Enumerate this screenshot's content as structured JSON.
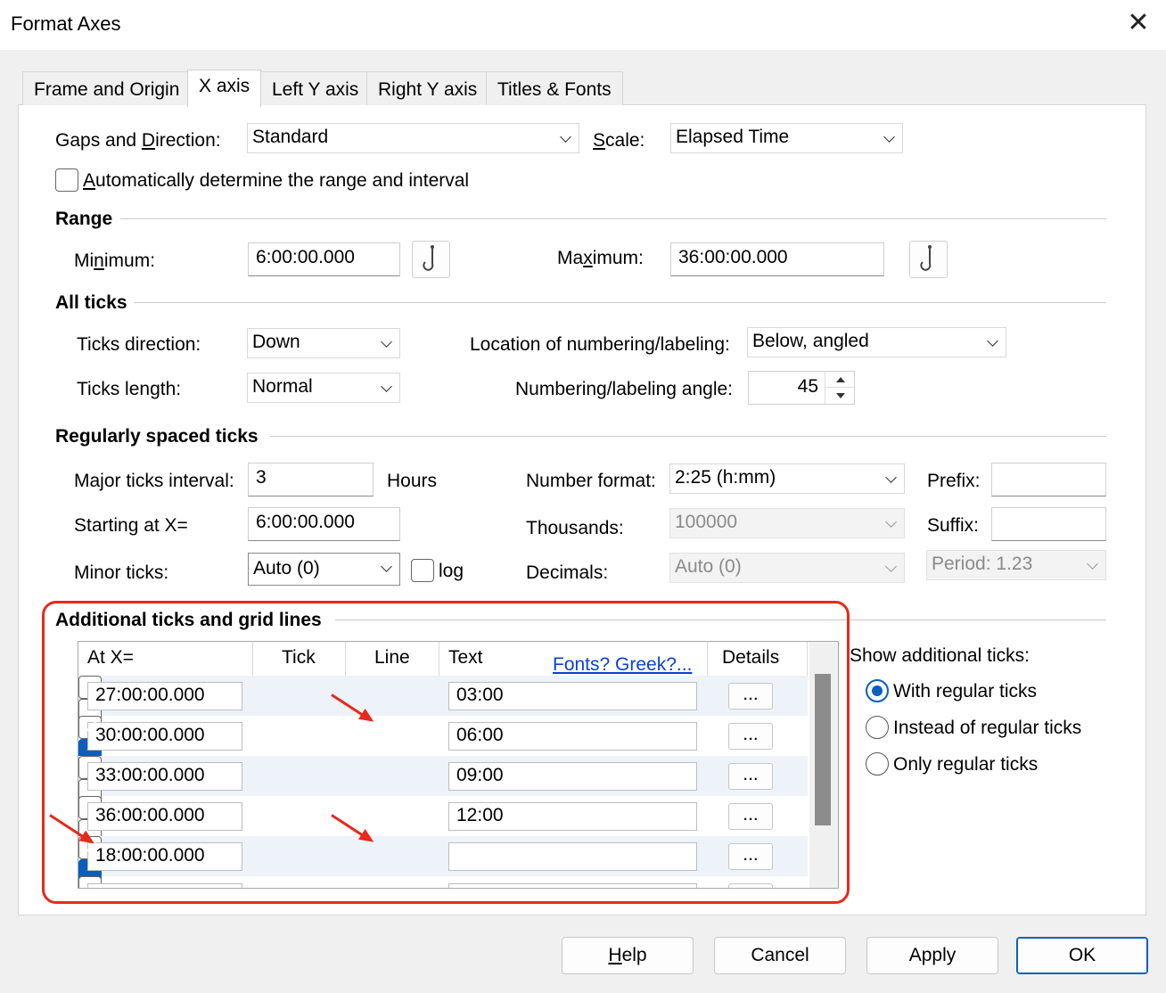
{
  "window": {
    "title": "Format Axes",
    "close_glyph": "✕"
  },
  "tabs": [
    "Frame and Origin",
    "X axis",
    "Left Y axis",
    "Right Y axis",
    "Titles & Fonts"
  ],
  "active_tab": "X axis",
  "gaps": {
    "label_pre": "Gaps and ",
    "label_key": "D",
    "label_post": "irection:",
    "value": "Standard"
  },
  "scale": {
    "label_key": "S",
    "label_post": "cale:",
    "value": "Elapsed Time"
  },
  "auto_range": {
    "label_key": "A",
    "label_post": "utomatically determine the range and interval",
    "checked": false
  },
  "range": {
    "heading": "Range",
    "min_label_pre": "Mi",
    "min_label_key": "n",
    "min_label_post": "imum:",
    "min_value": "6:00:00.000",
    "max_label_pre": "Ma",
    "max_label_key": "x",
    "max_label_post": "imum:",
    "max_value": "36:00:00.000",
    "hook_glyph": "⚓"
  },
  "all_ticks": {
    "heading": "All ticks",
    "direction_label": "Ticks direction:",
    "direction_value": "Down",
    "length_label": "Ticks length:",
    "length_value": "Normal",
    "location_label": "Location of numbering/labeling:",
    "location_value": "Below, angled",
    "angle_label": "Numbering/labeling angle:",
    "angle_value": "45"
  },
  "regular": {
    "heading": "Regularly spaced ticks",
    "major_label": "Major ticks interval:",
    "major_value": "3",
    "major_unit": "Hours",
    "start_label": "Starting at X=",
    "start_value": "6:00:00.000",
    "minor_label": "Minor ticks:",
    "minor_value": "Auto (0)",
    "log_label": "log",
    "log_checked": false,
    "numfmt_label": "Number format:",
    "numfmt_value": "2:25 (h:mm)",
    "thousands_label": "Thousands:",
    "thousands_value": "100000",
    "decimals_label": "Decimals:",
    "decimals_value": "Auto (0)",
    "prefix_label": "Prefix:",
    "prefix_value": "",
    "suffix_label": "Suffix:",
    "suffix_value": "",
    "period_value": "Period: 1.23"
  },
  "additional": {
    "heading": "Additional ticks and grid lines",
    "columns": {
      "at": "At X=",
      "tick": "Tick",
      "line": "Line",
      "text": "Text",
      "details": "Details"
    },
    "fonts_link": "Fonts? Greek?...",
    "details_btn": "...",
    "rows": [
      {
        "at": "27:00:00.000",
        "tick": false,
        "line": false,
        "text": "03:00"
      },
      {
        "at": "30:00:00.000",
        "tick": false,
        "line": true,
        "text": "06:00"
      },
      {
        "at": "33:00:00.000",
        "tick": false,
        "line": false,
        "text": "09:00"
      },
      {
        "at": "36:00:00.000",
        "tick": false,
        "line": false,
        "text": "12:00"
      },
      {
        "at": "18:00:00.000",
        "tick": false,
        "line": true,
        "text": ""
      }
    ],
    "show_label": "Show additional ticks:",
    "show_options": [
      "With regular ticks",
      "Instead of regular ticks",
      "Only regular ticks"
    ],
    "show_selected": 0
  },
  "buttons": {
    "help_key": "H",
    "help_post": "elp",
    "cancel": "Cancel",
    "apply": "Apply",
    "ok": "OK"
  },
  "colors": {
    "accent": "#0a5fbe",
    "annotation": "#e8291b",
    "link": "#0b3fd8"
  }
}
